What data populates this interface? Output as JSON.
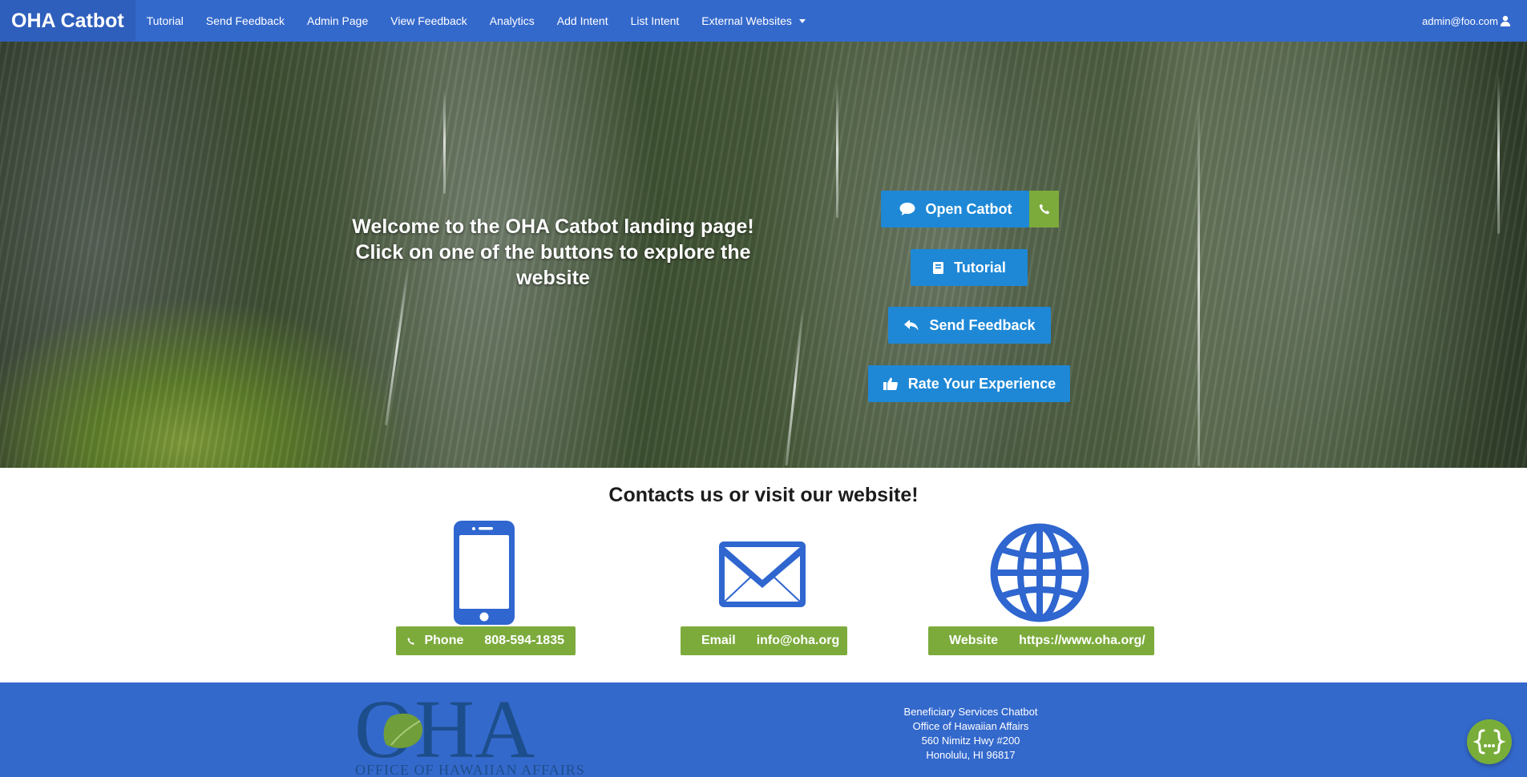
{
  "navbar": {
    "brand": "OHA Catbot",
    "items": [
      {
        "label": "Tutorial"
      },
      {
        "label": "Send Feedback"
      },
      {
        "label": "Admin Page"
      },
      {
        "label": "View Feedback"
      },
      {
        "label": "Analytics"
      },
      {
        "label": "Add Intent"
      },
      {
        "label": "List Intent"
      },
      {
        "label": "External Websites"
      }
    ],
    "user": "admin@foo.com"
  },
  "hero": {
    "welcome_line1": "Welcome to the OHA Catbot landing page!",
    "welcome_line2": "Click on one of the buttons to explore the",
    "welcome_line3": "website",
    "buttons": {
      "open_catbot": "Open Catbot",
      "tutorial": "Tutorial",
      "send_feedback": "Send Feedback",
      "rate": "Rate Your Experience"
    }
  },
  "contacts": {
    "title": "Contacts us or visit our website!",
    "phone": {
      "label": "Phone",
      "value": "808-594-1835"
    },
    "email": {
      "label": "Email",
      "value": "info@oha.org"
    },
    "website": {
      "label": "Website",
      "value": "https://www.oha.org/"
    }
  },
  "footer": {
    "logo_text": "OHA",
    "logo_subtitle": "OFFICE OF HAWAIIAN AFFAIRS",
    "address": {
      "line1": "Beneficiary Services Chatbot",
      "line2": "Office of Hawaiian Affairs",
      "line3": "560 Nimitz Hwy #200",
      "line4": "Honolulu, HI 96817"
    }
  },
  "colors": {
    "primary": "#3469cc",
    "button_blue": "#1e88d6",
    "accent_green": "#7cab3c",
    "icon_blue": "#2f66cf",
    "logo_dark": "#1d4e8c"
  },
  "icons": {
    "phone": "phone-icon",
    "email": "envelope-icon",
    "website": "globe-icon",
    "chat": "chat-bubble-icon",
    "tutorial": "book-icon",
    "feedback": "reply-icon",
    "rate": "thumbs-up-icon",
    "user": "user-icon",
    "cursor": "pointer-icon",
    "fab": "code-braces-icon"
  }
}
